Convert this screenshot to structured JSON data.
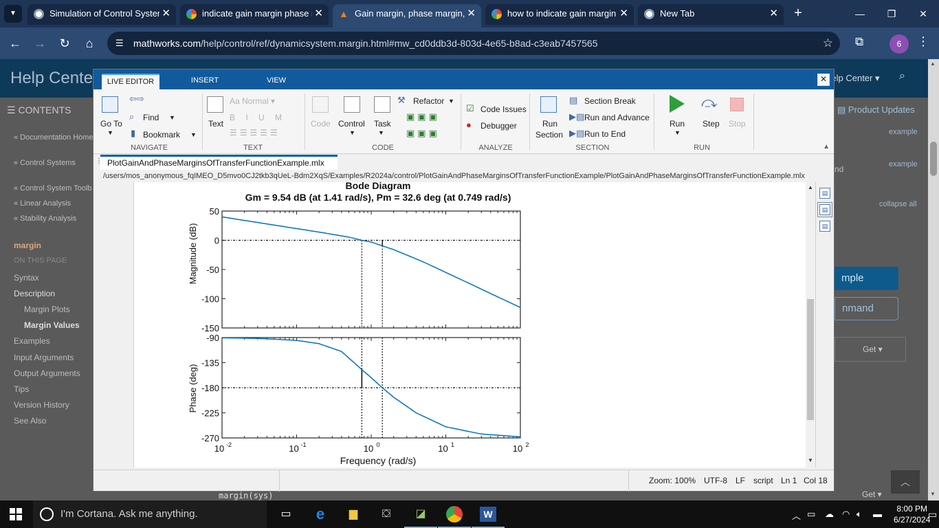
{
  "browser": {
    "tabs": [
      {
        "title": "Simulation of Control System",
        "favicon": "chrome-globe"
      },
      {
        "title": "indicate gain margin phase m",
        "favicon": "google"
      },
      {
        "title": "Gain margin, phase margin,",
        "favicon": "mathworks"
      },
      {
        "title": "how to indicate gain margin",
        "favicon": "google"
      },
      {
        "title": "New Tab",
        "favicon": "chrome"
      }
    ],
    "url_host": "mathworks.com",
    "url_path": "/help/control/ref/dynamicsystem.margin.html#mw_cd0ddb3d-803d-4e65-b8ad-c3eab7457565",
    "profile_initial": "6"
  },
  "help_page": {
    "title": "Help Center",
    "search_label": "Help Center",
    "contents_label": "CONTENTS",
    "nav": [
      "« Documentation Home",
      "« Control Systems",
      "« Control System Toolb",
      "« Linear Analysis",
      "« Stability Analysis"
    ],
    "current": "margin",
    "on_this_page": "ON THIS PAGE",
    "toc": [
      "Syntax",
      "Description",
      "Margin Plots",
      "Margin Values",
      "Examples",
      "Input Arguments",
      "Output Arguments",
      "Tips",
      "Version History",
      "See Also"
    ],
    "product_updates": "Product Updates",
    "example1": "example",
    "example2": "example",
    "nd": "nd",
    "collapse_all": "collapse all",
    "open_example": "mple",
    "command": "nmand",
    "get": "Get",
    "code_peek": "margin(sys)"
  },
  "matlab": {
    "tabs": [
      "LIVE EDITOR",
      "INSERT",
      "VIEW"
    ],
    "close": "✕",
    "navigate": {
      "goto": "Go To",
      "find": "Find",
      "bookmark": "Bookmark",
      "section": "NAVIGATE"
    },
    "text": {
      "style": "Normal",
      "text_label": "Text",
      "section": "TEXT"
    },
    "code": {
      "refactor": "Refactor",
      "code_label": "Code",
      "control": "Control",
      "task": "Task",
      "section": "CODE"
    },
    "analyze": {
      "issues": "Code Issues",
      "debugger": "Debugger",
      "section": "ANALYZE"
    },
    "section_grp": {
      "run_section": "Run\nSection",
      "run_section_a": "Run",
      "run_section_b": "Section",
      "break": "Section Break",
      "advance": "Run and Advance",
      "to_end": "Run to End",
      "section": "SECTION"
    },
    "run": {
      "run": "Run",
      "step": "Step",
      "stop": "Stop",
      "section": "RUN"
    },
    "doc_tab": "PlotGainAndPhaseMarginsOfTransferFunctionExample.mlx",
    "path": "/users/mos_anonymous_fqIMEO_D5mvo0CJ2tkb3qUeL-Bdm2XqS/Examples/R2024a/control/PlotGainAndPhaseMarginsOfTransferFunctionExample/PlotGainAndPhaseMarginsOfTransferFunctionExample.mlx",
    "status": {
      "zoom": "Zoom: 100%",
      "encoding": "UTF-8",
      "eol": "LF",
      "mode": "script",
      "ln": "Ln  1",
      "col": "Col  18"
    }
  },
  "chart_data": {
    "type": "line",
    "title": "Bode Diagram",
    "subtitle": "Gm = 9.54 dB (at 1.41 rad/s),  Pm = 32.6 deg (at 0.749 rad/s)",
    "xlabel": "Frequency  (rad/s)",
    "xscale": "log",
    "xlim": [
      0.01,
      100
    ],
    "xticks": [
      0.01,
      0.1,
      1,
      10,
      100
    ],
    "xtick_labels": [
      {
        "base": "10",
        "exp": "-2"
      },
      {
        "base": "10",
        "exp": "-1"
      },
      {
        "base": "10",
        "exp": "0"
      },
      {
        "base": "10",
        "exp": "1"
      },
      {
        "base": "10",
        "exp": "2"
      }
    ],
    "magnitude": {
      "ylabel": "Magnitude (dB)",
      "ylim": [
        -150,
        50
      ],
      "yticks": [
        50,
        0,
        -50,
        -100,
        -150
      ],
      "x": [
        0.01,
        0.02,
        0.05,
        0.1,
        0.2,
        0.5,
        0.749,
        1,
        1.41,
        2,
        5,
        10,
        20,
        50,
        100
      ],
      "y": [
        40,
        34,
        26,
        20,
        14,
        5.5,
        0,
        -3,
        -9.5,
        -16,
        -37,
        -55,
        -73,
        -97,
        -115
      ]
    },
    "phase": {
      "ylabel": "Phase (deg)",
      "ylim": [
        -270,
        -90
      ],
      "yticks": [
        -90,
        -135,
        -180,
        -225,
        -270
      ],
      "x": [
        0.01,
        0.03,
        0.1,
        0.2,
        0.4,
        0.749,
        1,
        1.41,
        2,
        4,
        10,
        30,
        100
      ],
      "y": [
        -90.5,
        -91.5,
        -95,
        -101,
        -115,
        -147.4,
        -162,
        -180,
        -197,
        -225,
        -250,
        -263,
        -268
      ]
    },
    "gain_margin": {
      "value_db": 9.54,
      "freq": 1.41
    },
    "phase_margin": {
      "value_deg": 32.6,
      "freq": 0.749
    },
    "line_color": "#0072BD"
  },
  "taskbar": {
    "cortana": "I'm Cortana. Ask me anything.",
    "time": "8:00 PM",
    "date": "6/27/2024"
  }
}
